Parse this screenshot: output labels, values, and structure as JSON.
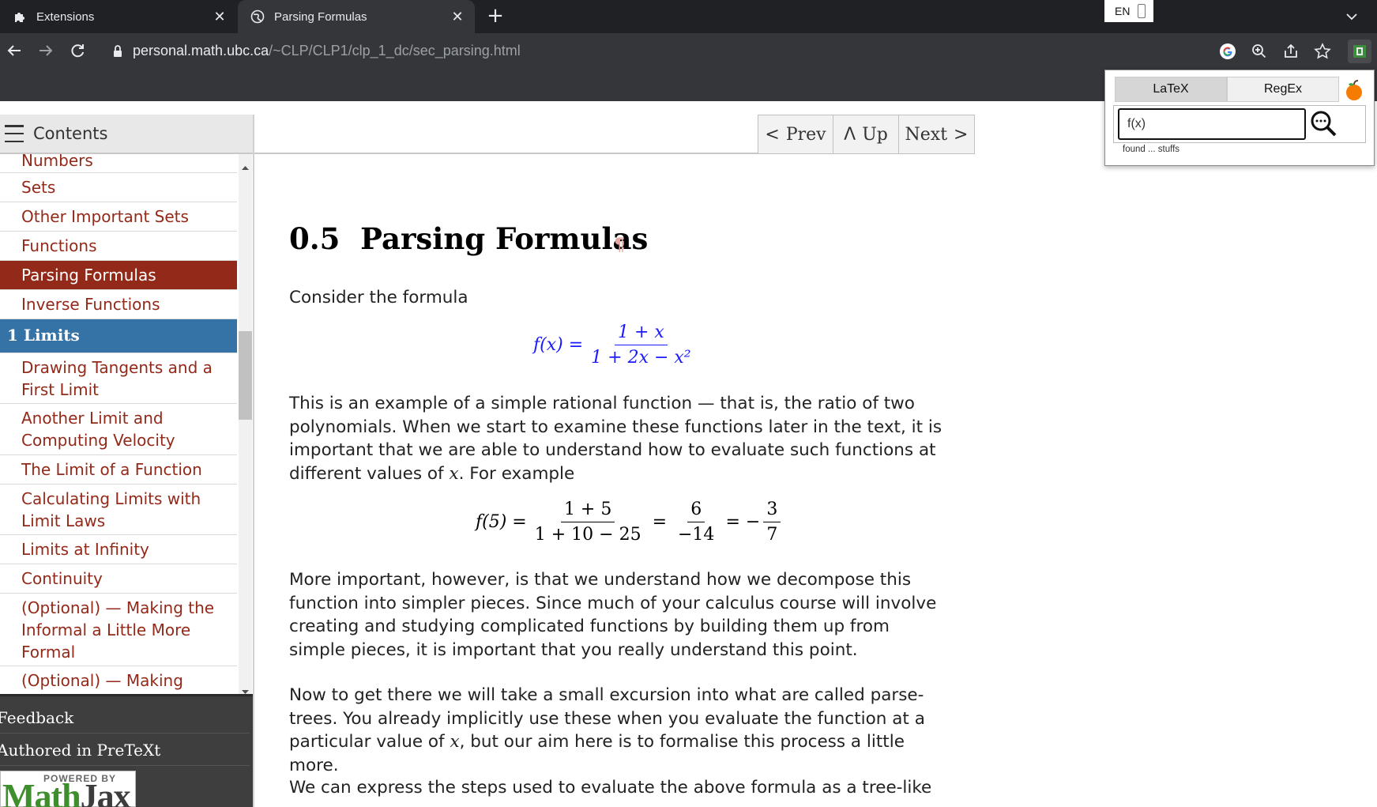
{
  "browser": {
    "tabs": [
      {
        "title": "Extensions",
        "icon": "puzzle-icon"
      },
      {
        "title": "Parsing Formulas",
        "icon": "globe-icon"
      }
    ],
    "language_indicator": "EN",
    "url_host": "personal.math.ubc.ca",
    "url_path": "/~CLP/CLP1/clp_1_dc/sec_parsing.html"
  },
  "extension_popup": {
    "tab_latex": "LaTeX",
    "tab_regex": "RegEx",
    "search_value": "f(x)",
    "status": "found ... stuffs"
  },
  "sidebar": {
    "title": "Contents",
    "items": [
      {
        "label": "Numbers"
      },
      {
        "label": "Sets"
      },
      {
        "label": "Other Important Sets"
      },
      {
        "label": "Functions"
      },
      {
        "label": "Parsing Formulas",
        "active": true
      },
      {
        "label": "Inverse Functions"
      },
      {
        "label": "1 Limits",
        "chapter": true
      },
      {
        "label": "Drawing Tangents and a First Limit"
      },
      {
        "label": "Another Limit and Computing Velocity"
      },
      {
        "label": "The Limit of a Function"
      },
      {
        "label": "Calculating Limits with Limit Laws"
      },
      {
        "label": "Limits at Infinity"
      },
      {
        "label": "Continuity"
      },
      {
        "label": "(Optional) — Making the Informal a Little More Formal"
      },
      {
        "label": "(Optional) — Making Infinite"
      }
    ],
    "feedback": "Feedback",
    "authored": "Authored in PreTeXt",
    "powered_by": "POWERED BY",
    "mathjax_math": "Math",
    "mathjax_jax": "Jax"
  },
  "nav": {
    "prev": "Prev",
    "up": "Up",
    "next": "Next"
  },
  "content": {
    "section_number": "0.5",
    "section_title": "Parsing Formulas",
    "para1": "Consider the formula",
    "para2_a": "This is an example of a simple rational function — that is, the ratio of two polynomials. When we start to examine these functions later in the text, it is important that we are able to understand how to evaluate such functions at different values of ",
    "para2_var": "x",
    "para2_b": ". For example",
    "para3": "More important, however, is that we understand how we decompose this function into simpler pieces. Since much of your calculus course will involve creating and studying complicated functions by building them up from simple pieces, it is important that you really understand this point.",
    "para4_a": "Now to get there we will take a small excursion into what are called parse-trees. You already implicitly use these when you evaluate the function at a particular value of ",
    "para4_var": "x",
    "para4_b": ", but our aim here is to formalise this process a little more.",
    "para5": "We can express the steps used to evaluate the above formula as a tree-like",
    "eq1": {
      "lhs": "f(x) =",
      "num": "1 + x",
      "den": "1 + 2x − x²"
    },
    "eq2": {
      "lhs": "f(5) =",
      "num1": "1 + 5",
      "den1": "1 + 10 − 25",
      "eq_a": "=",
      "num2": "6",
      "den2": "−14",
      "eq_b": "= −",
      "num3": "3",
      "den3": "7"
    }
  },
  "colors": {
    "accent_red": "#932919",
    "chapter_blue": "#3572a5",
    "formula_highlight": "#1a1aff"
  }
}
